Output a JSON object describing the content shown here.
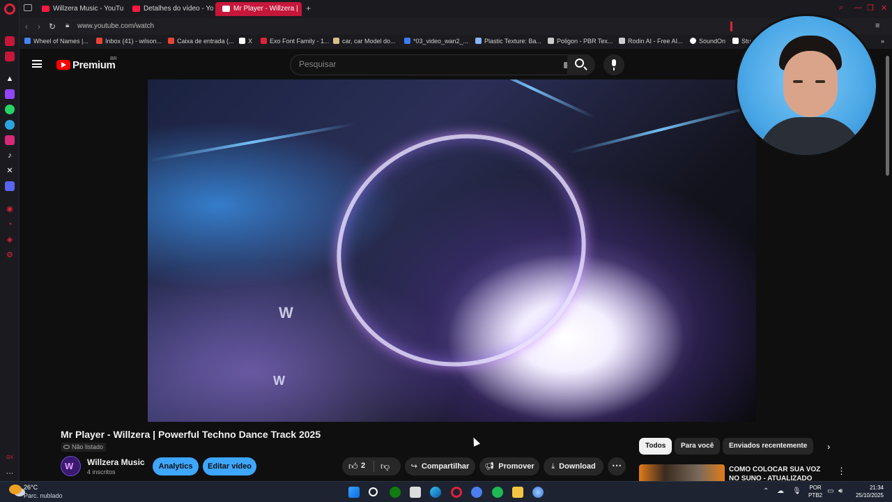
{
  "browser": {
    "tabs": [
      {
        "label": "Willzera Music - YouTube"
      },
      {
        "label": "Detalhes do vídeo - YouT"
      },
      {
        "label": "Mr Player - Willzera |"
      }
    ],
    "url": "www.youtube.com/watch",
    "bookmarks": [
      {
        "label": "Wheel of Names |...",
        "color": "#4285f4"
      },
      {
        "label": "Inbox (41) - wilson...",
        "color": "#ea4335"
      },
      {
        "label": "Caixa de entrada (...",
        "color": "#ea4335"
      },
      {
        "label": "X",
        "color": "#ffffff"
      },
      {
        "label": "Exo Font Family - 1...",
        "color": "#e0223b"
      },
      {
        "label": "car, car Model do...",
        "color": "#d4c08a"
      },
      {
        "label": "*03_video_wan2_...",
        "color": "#3d7cf0"
      },
      {
        "label": "Plastic Texture: Ba...",
        "color": "#8ab4f8"
      },
      {
        "label": "Poligon - PBR Tex...",
        "color": "#cccccc"
      },
      {
        "label": "Rodin AI - Free AI...",
        "color": "#cccccc"
      },
      {
        "label": "SoundOn",
        "color": "#ffffff"
      },
      {
        "label": "Stu",
        "color": "#ffffff"
      }
    ]
  },
  "youtube": {
    "brand": "Premium",
    "region": "BR",
    "search_placeholder": "Pesquisar"
  },
  "video": {
    "title": "Mr Player - Willzera | Powerful Techno Dance Track 2025",
    "visibility": "Não listado",
    "channel_name": "Willzera Music",
    "subscribers": "4 inscritos",
    "avatar_letter": "W",
    "watermark": "W",
    "buttons": {
      "analytics": "Analytics",
      "edit": "Editar vídeo",
      "like_count": "2",
      "share": "Compartilhar",
      "promote": "Promover",
      "download": "Download"
    }
  },
  "chips": [
    "Todos",
    "Para você",
    "Enviados recentemente"
  ],
  "recommendation": {
    "title": "COMO COLOCAR SUA VOZ NO SUNO - ATUALIZADO"
  },
  "taskbar": {
    "temperature": "26°C",
    "condition": "Parc. nublado",
    "lang_top": "POR",
    "lang_bottom": "PTB2",
    "time": "21:34",
    "date": "25/10/2025"
  },
  "colors": {
    "accent_opera": "#e0223b",
    "youtube_red": "#ff0000",
    "button_blue": "#3ea6ff"
  }
}
